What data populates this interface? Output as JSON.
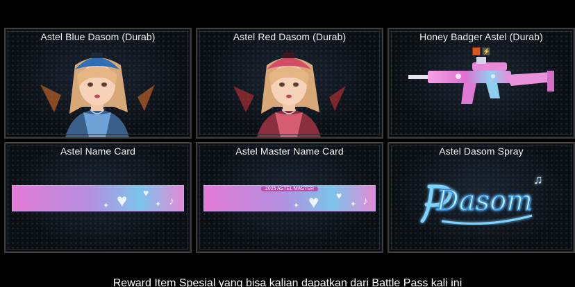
{
  "subtitle": "Reward Item Spesial yang bisa kalian dapatkan dari Battle Pass kali ini",
  "cards": [
    {
      "title": "Astel Blue Dasom (Durab)"
    },
    {
      "title": "Astel Red Dasom (Durab)"
    },
    {
      "title": "Honey Badger Astel (Durab)"
    },
    {
      "title": "Astel Name Card"
    },
    {
      "title": "Astel Master Name Card",
      "banner_text": "2025 ASTEL MASTER"
    },
    {
      "title": "Astel Dasom Spray",
      "spray_text": "Dasom"
    }
  ],
  "colors": {
    "card_border": "#3d3d3d",
    "blue_cap": "#2f6fb5",
    "red_cap": "#d24d68",
    "rifle_pink": "#f07fd8",
    "rifle_cyan": "#7fd6f0",
    "spray_blue": "#7fd3ff"
  }
}
